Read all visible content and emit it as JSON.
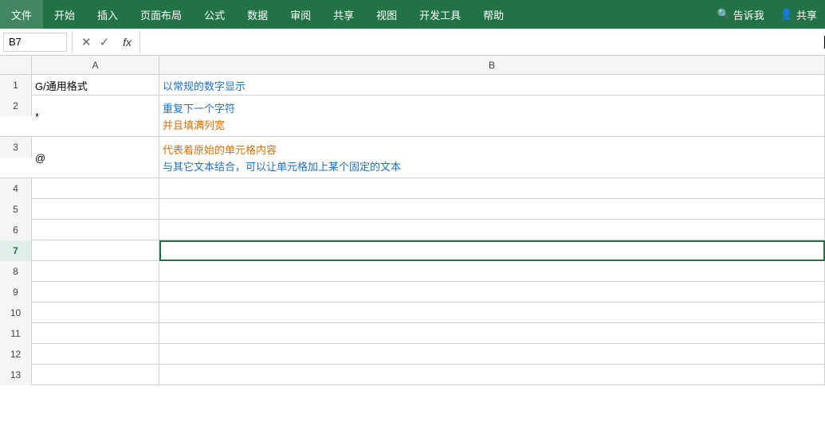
{
  "ribbon": {
    "items": [
      "文件",
      "开始",
      "插入",
      "页面布局",
      "公式",
      "数据",
      "审阅",
      "共享",
      "视图",
      "开发工具",
      "帮助"
    ],
    "right_items": [
      "告诉我",
      "共享"
    ]
  },
  "formula_bar": {
    "cell_ref": "B7",
    "fx_label": "fx",
    "cancel_icon": "✕",
    "confirm_icon": "✓"
  },
  "columns": {
    "corner": "",
    "col_a_label": "A",
    "col_b_label": "B",
    "col_a_width": 160,
    "col_b_width": 780
  },
  "rows": [
    {
      "row_num": "1",
      "col_a": "G/通用格式",
      "col_b_text": "以常规的数字显示",
      "col_b_color": "blue",
      "height": "normal"
    },
    {
      "row_num": "2",
      "col_a": "*",
      "col_b_text": "重复下一个字符\n并且填满列宽",
      "col_b_color": "mixed",
      "height": "tall"
    },
    {
      "row_num": "3",
      "col_a": "@",
      "col_b_text": "代表着原始的单元格内容\n与其它文本结合，可以让单元格加上某个固定的文本",
      "col_b_color": "mixed",
      "height": "tall"
    },
    {
      "row_num": "4",
      "col_a": "",
      "col_b_text": "",
      "height": "normal"
    },
    {
      "row_num": "5",
      "col_a": "",
      "col_b_text": "",
      "height": "normal"
    },
    {
      "row_num": "6",
      "col_a": "",
      "col_b_text": "",
      "height": "normal"
    },
    {
      "row_num": "7",
      "col_a": "",
      "col_b_text": "",
      "height": "normal"
    },
    {
      "row_num": "8",
      "col_a": "",
      "col_b_text": "",
      "height": "normal"
    },
    {
      "row_num": "9",
      "col_a": "",
      "col_b_text": "",
      "height": "normal"
    },
    {
      "row_num": "10",
      "col_a": "",
      "col_b_text": "",
      "height": "normal"
    },
    {
      "row_num": "11",
      "col_a": "",
      "col_b_text": "",
      "height": "normal"
    },
    {
      "row_num": "12",
      "col_a": "",
      "col_b_text": "",
      "height": "normal"
    },
    {
      "row_num": "13",
      "col_a": "",
      "col_b_text": "",
      "height": "normal"
    }
  ],
  "selected_cell": "B7",
  "colors": {
    "ribbon_bg": "#217346",
    "ribbon_text": "#ffffff",
    "header_bg": "#f5f5f5",
    "grid_line": "#d0d0d0",
    "blue_text": "#1f6fbf",
    "orange_text": "#d4700a"
  }
}
